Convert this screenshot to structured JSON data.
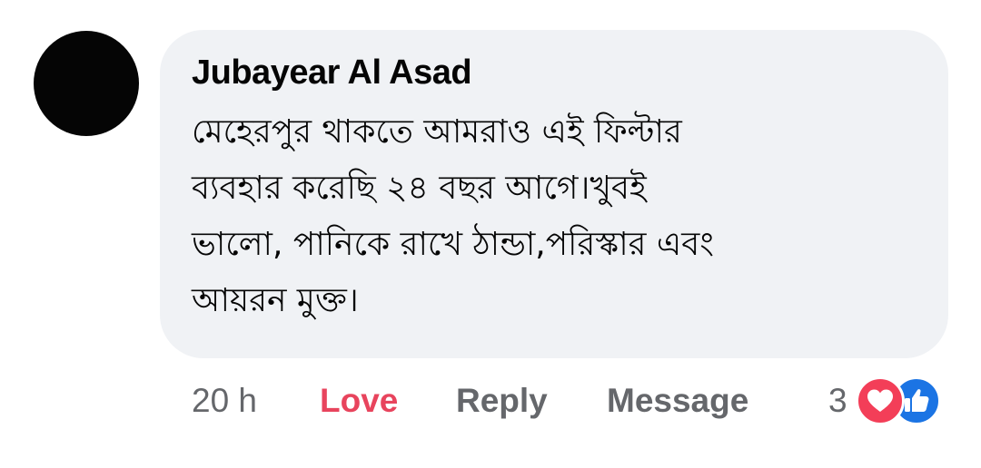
{
  "comment": {
    "author": "Jubayear Al Asad",
    "text_lines": [
      "মেহেরপুর থাকতে আমরাও এই ফিল্টার",
      "ব্যবহার করেছি ২৪ বছর আগে।খুবই",
      "ভালো, পানিকে রাখে ঠান্ডা,পরিস্কার এবং",
      "আয়রন মুক্ত।"
    ]
  },
  "actions": {
    "time": "20 h",
    "love": "Love",
    "reply": "Reply",
    "message": "Message",
    "reaction_count": "3"
  },
  "reactions": [
    {
      "icon": "heart-icon",
      "color": "#f33e58"
    },
    {
      "icon": "thumbs-up-icon",
      "color": "#1b74e4"
    }
  ],
  "colors": {
    "bubble_bg": "#f0f2f5",
    "love_active": "#e8445d",
    "meta_text": "#65676b"
  }
}
